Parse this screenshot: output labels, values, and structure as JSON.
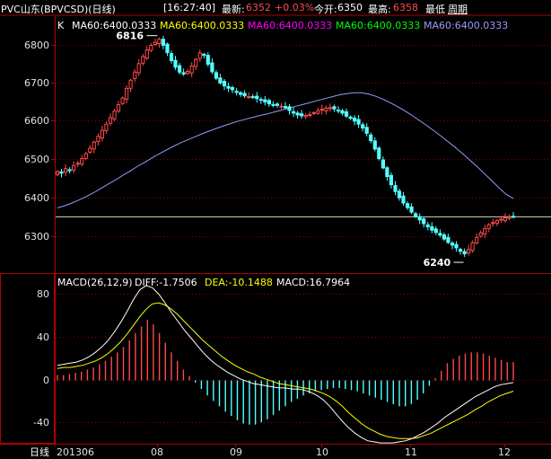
{
  "header": {
    "title": "PVC山东(BPVCSD)(日线)",
    "time": "[16:27:40]",
    "latest_label": "最新:",
    "latest_value": "6352",
    "change": "+0.03%",
    "open_label": "今开:",
    "open_value": "6350",
    "high_label": "最高:",
    "high_value": "6358",
    "best_label": "最低",
    "period_label": "周期"
  },
  "main_legend": {
    "k_label": "K",
    "items": [
      {
        "text": "MA60:6400.0333",
        "color": "#ffffff"
      },
      {
        "text": "MA60:6400.0333",
        "color": "#ffff00"
      },
      {
        "text": "MA60:6400.0333",
        "color": "#ff00ff"
      },
      {
        "text": "MA60:6400.0333",
        "color": "#00ff00"
      },
      {
        "text": "MA60:6400.0333",
        "color": "#9999ff"
      }
    ]
  },
  "annotations": {
    "high": "6816",
    "low": "6240"
  },
  "price_axis": {
    "ticks": [
      "6800",
      "6700",
      "6600",
      "6500",
      "6400",
      "6300"
    ]
  },
  "macd_legend": {
    "label": "MACD(26,12,9)",
    "diff": "DIFF:-1.7506",
    "dea": "DEA:-10.1488",
    "macd": "MACD:16.7964"
  },
  "macd_axis": {
    "ticks": [
      "80",
      "40",
      "0",
      "-40"
    ]
  },
  "bottom_axis": {
    "period": "日线",
    "labels": [
      "201306",
      "08",
      "09",
      "10",
      "11",
      "12"
    ]
  },
  "colors": {
    "up": "#ff4a4a",
    "down": "#54ffff",
    "ma": "#9999ff",
    "diff": "#ffffff",
    "dea": "#ffff00",
    "frame": "#b00000",
    "reference_line": "#d8d8b0"
  },
  "chart_data": [
    {
      "type": "candlestick",
      "title": "PVC山东(BPVCSD)(日线)",
      "ylim": [
        6240,
        6850
      ],
      "reference_line": 6352,
      "high_marker": 6816,
      "low_marker": 6240,
      "close": [
        6470,
        6466,
        6478,
        6474,
        6486,
        6492,
        6504,
        6517,
        6531,
        6547,
        6562,
        6578,
        6594,
        6611,
        6628,
        6645,
        6662,
        6687,
        6709,
        6730,
        6752,
        6771,
        6788,
        6800,
        6808,
        6816,
        6800,
        6781,
        6760,
        6743,
        6730,
        6725,
        6732,
        6746,
        6763,
        6780,
        6774,
        6751,
        6731,
        6714,
        6702,
        6694,
        6688,
        6684,
        6677,
        6672,
        6668,
        6666,
        6664,
        6661,
        6657,
        6652,
        6647,
        6645,
        6643,
        6641,
        6637,
        6630,
        6623,
        6618,
        6616,
        6617,
        6619,
        6624,
        6629,
        6633,
        6636,
        6637,
        6634,
        6629,
        6623,
        6615,
        6609,
        6602,
        6594,
        6584,
        6570,
        6551,
        6529,
        6504,
        6480,
        6457,
        6436,
        6418,
        6402,
        6388,
        6376,
        6364,
        6353,
        6344,
        6334,
        6326,
        6317,
        6311,
        6304,
        6294,
        6285,
        6278,
        6271,
        6262,
        6255,
        6267,
        6284,
        6298,
        6310,
        6321,
        6331,
        6337,
        6342,
        6346,
        6349,
        6351,
        6352
      ]
    },
    {
      "type": "line",
      "title": "MA60",
      "values": [
        6375,
        6381,
        6388,
        6396,
        6405,
        6415,
        6426,
        6437,
        6448,
        6460,
        6471,
        6483,
        6494,
        6505,
        6516,
        6526,
        6536,
        6545,
        6553,
        6561,
        6569,
        6576,
        6583,
        6590,
        6596,
        6602,
        6607,
        6612,
        6617,
        6621,
        6626,
        6631,
        6636,
        6641,
        6646,
        6651,
        6656,
        6661,
        6666,
        6671,
        6674,
        6676,
        6676,
        6673,
        6667,
        6659,
        6650,
        6640,
        6629,
        6617,
        6604,
        6591,
        6577,
        6563,
        6548,
        6533,
        6517,
        6500,
        6483,
        6465,
        6447,
        6428,
        6411,
        6400
      ]
    },
    {
      "type": "bar",
      "title": "MACD(26,12,9)",
      "ylim": [
        -62,
        94
      ],
      "macd_histogram": [
        5,
        5,
        6,
        7,
        8,
        10,
        12,
        15,
        18,
        22,
        26,
        31,
        37,
        44,
        50,
        56,
        52,
        44,
        35,
        26,
        18,
        10,
        4,
        -2,
        -8,
        -14,
        -19,
        -24,
        -29,
        -33,
        -37,
        -40,
        -41,
        -41,
        -39,
        -36,
        -32,
        -28,
        -24,
        -20,
        -17,
        -14,
        -12,
        -10,
        -9,
        -8,
        -7,
        -7,
        -8,
        -9,
        -10,
        -12,
        -14,
        -16,
        -18,
        -20,
        -22,
        -24,
        -24,
        -22,
        -18,
        -12,
        -5,
        2,
        9,
        16,
        20,
        23,
        25,
        26,
        26,
        25,
        23,
        21,
        19,
        17,
        17
      ],
      "diff": [
        14,
        15,
        16,
        17,
        19,
        22,
        26,
        31,
        37,
        45,
        54,
        64,
        75,
        84,
        88,
        86,
        80,
        72,
        63,
        55,
        47,
        40,
        33,
        26,
        20,
        15,
        11,
        7,
        4,
        1,
        -1,
        -3,
        -4,
        -5,
        -6,
        -7,
        -7,
        -8,
        -8,
        -9,
        -11,
        -14,
        -18,
        -24,
        -31,
        -38,
        -44,
        -49,
        -53,
        -56,
        -57,
        -58,
        -58,
        -58,
        -57,
        -56,
        -54,
        -51,
        -48,
        -44,
        -40,
        -35,
        -31,
        -27,
        -23,
        -19,
        -15,
        -12,
        -9,
        -6,
        -4,
        -3,
        -2
      ],
      "dea": [
        11,
        12,
        12,
        13,
        14,
        16,
        18,
        21,
        25,
        30,
        36,
        43,
        51,
        59,
        66,
        71,
        72,
        70,
        66,
        61,
        55,
        49,
        43,
        37,
        32,
        27,
        22,
        18,
        14,
        11,
        8,
        6,
        3,
        1,
        -1,
        -3,
        -4,
        -5,
        -6,
        -7,
        -8,
        -10,
        -12,
        -15,
        -19,
        -24,
        -30,
        -35,
        -40,
        -44,
        -47,
        -50,
        -52,
        -53,
        -54,
        -54,
        -54,
        -53,
        -51,
        -49,
        -46,
        -43,
        -40,
        -37,
        -34,
        -31,
        -27,
        -24,
        -20,
        -17,
        -14,
        -12,
        -10
      ]
    }
  ]
}
